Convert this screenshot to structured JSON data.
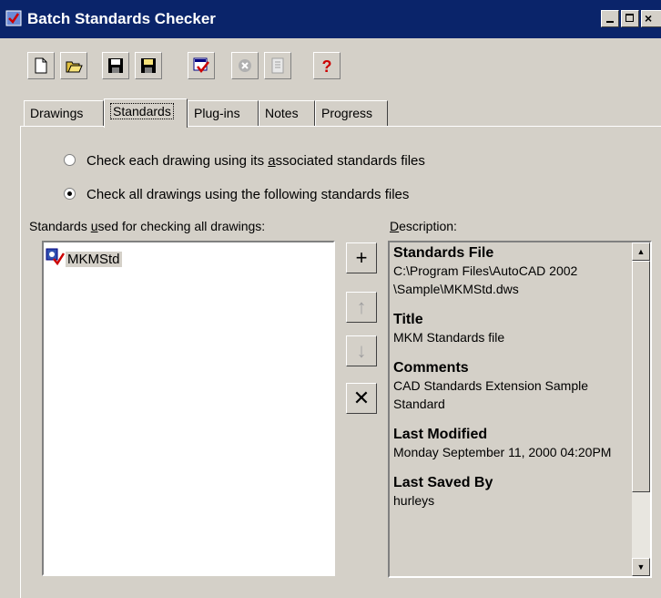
{
  "window": {
    "title": "Batch Standards Checker",
    "minimize_glyph": "_",
    "maximize_glyph": "□",
    "close_glyph": "×"
  },
  "toolbar": {
    "buttons": [
      {
        "name": "new-icon"
      },
      {
        "name": "open-icon"
      },
      {
        "name": "save-icon"
      },
      {
        "name": "save-as-icon"
      },
      {
        "name": "start-check-icon"
      },
      {
        "name": "stop-check-icon"
      },
      {
        "name": "view-report-icon"
      },
      {
        "name": "help-icon"
      }
    ]
  },
  "tabs": [
    {
      "label": "Drawings"
    },
    {
      "label": "Standards"
    },
    {
      "label": "Plug-ins"
    },
    {
      "label": "Notes"
    },
    {
      "label": "Progress"
    }
  ],
  "active_tab": "Standards",
  "options": {
    "radio1": {
      "before": "Check each drawing using its ",
      "ul": "a",
      "after": "ssociated standards files",
      "checked": false
    },
    "radio2": {
      "before": "Check all drawings using the followin",
      "ul": "g",
      "after": " standards files",
      "checked": true
    }
  },
  "list_label": {
    "before": "Standards ",
    "ul": "u",
    "after": "sed for checking all drawings:"
  },
  "desc_label": {
    "ul": "D",
    "after": "escription:"
  },
  "standards_list": [
    {
      "label": "MKMStd"
    }
  ],
  "side_buttons": {
    "add": "+",
    "move_up": "↑",
    "move_down": "↓",
    "remove": "✕"
  },
  "description": [
    {
      "heading": "Standards File",
      "value": "C:\\Program Files\\AutoCAD 2002\n\\Sample\\MKMStd.dws"
    },
    {
      "heading": "Title",
      "value": "MKM Standards file"
    },
    {
      "heading": "Comments",
      "value": "CAD Standards Extension Sample Standard"
    },
    {
      "heading": "Last Modified",
      "value": "Monday September 11, 2000 04:20PM"
    },
    {
      "heading": "Last Saved By",
      "value": "hurleys"
    }
  ],
  "colors": {
    "titlebar": "#0a246a",
    "face": "#d4d0c8",
    "check_red": "#cc0000",
    "help_red": "#cc0000"
  }
}
